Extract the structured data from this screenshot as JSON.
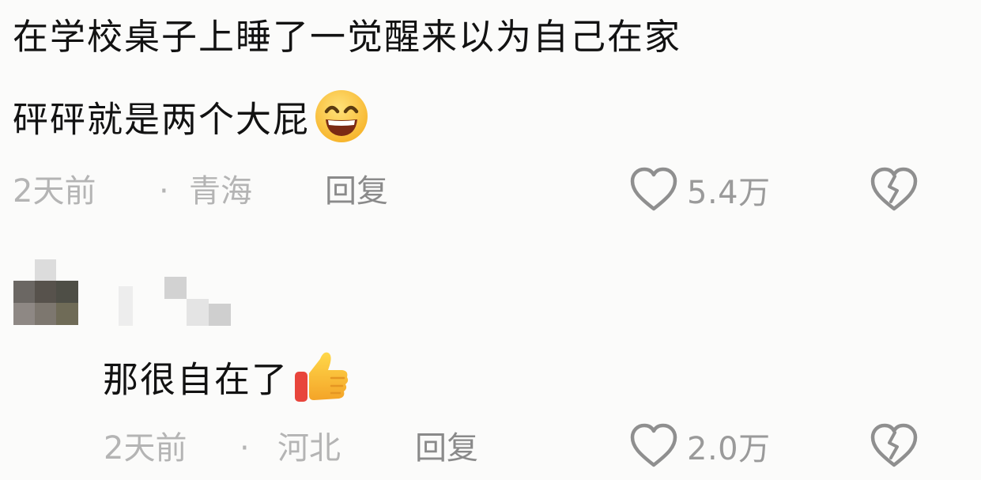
{
  "comments": [
    {
      "text_line1": "在学校桌子上睡了一觉醒来以为自己在家",
      "text_line2": "砰砰就是两个大屁",
      "time": "2天前",
      "separator": "·",
      "location": "青海",
      "reply_label": "回复",
      "likes": "5.4万",
      "emoji": "grinning-face-emoji"
    },
    {
      "text": "那很自在了",
      "time": "2天前",
      "separator": "·",
      "location": "河北",
      "reply_label": "回复",
      "likes": "2.0万",
      "emoji": "thumbs-up-emoji"
    }
  ],
  "icons": {
    "like": "heart-outline-icon",
    "dislike": "broken-heart-icon"
  },
  "colors": {
    "background": "#fbfbfa",
    "text": "#121212",
    "meta": "#b4b4b4",
    "icon": "#8f8f8f"
  }
}
